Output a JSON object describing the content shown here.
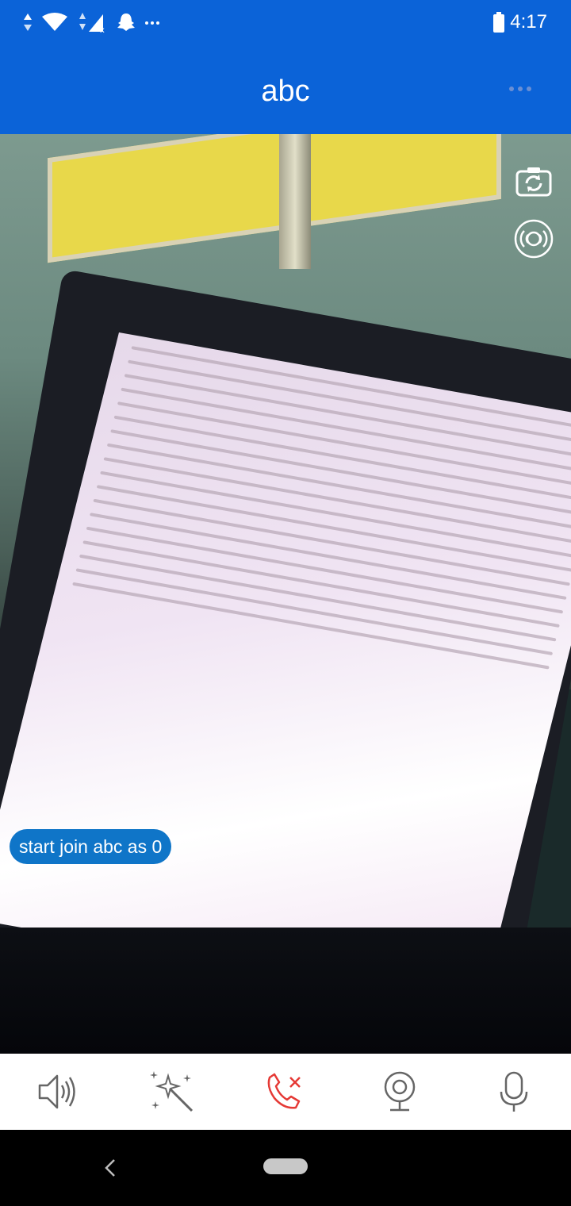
{
  "status_bar": {
    "time": "4:17",
    "icons": [
      "data-arrows-icon",
      "wifi-icon",
      "signal-icon",
      "snapchat-icon",
      "more-notifications-icon",
      "battery-icon"
    ]
  },
  "app_bar": {
    "title": "abc",
    "more_icon": "more-horizontal-icon"
  },
  "video": {
    "join_status": "start join abc as 0",
    "controls": [
      "switch-camera-icon",
      "audio-route-icon"
    ]
  },
  "toolbar": {
    "items": [
      {
        "name": "speaker",
        "icon": "speaker-icon"
      },
      {
        "name": "effects",
        "icon": "magic-wand-icon"
      },
      {
        "name": "hang-up",
        "icon": "end-call-icon",
        "color": "#e53935"
      },
      {
        "name": "camera",
        "icon": "webcam-icon"
      },
      {
        "name": "microphone",
        "icon": "microphone-icon"
      }
    ]
  },
  "colors": {
    "brand": "#0b63d8",
    "badge": "#0f75c8",
    "hangup": "#e53935"
  }
}
